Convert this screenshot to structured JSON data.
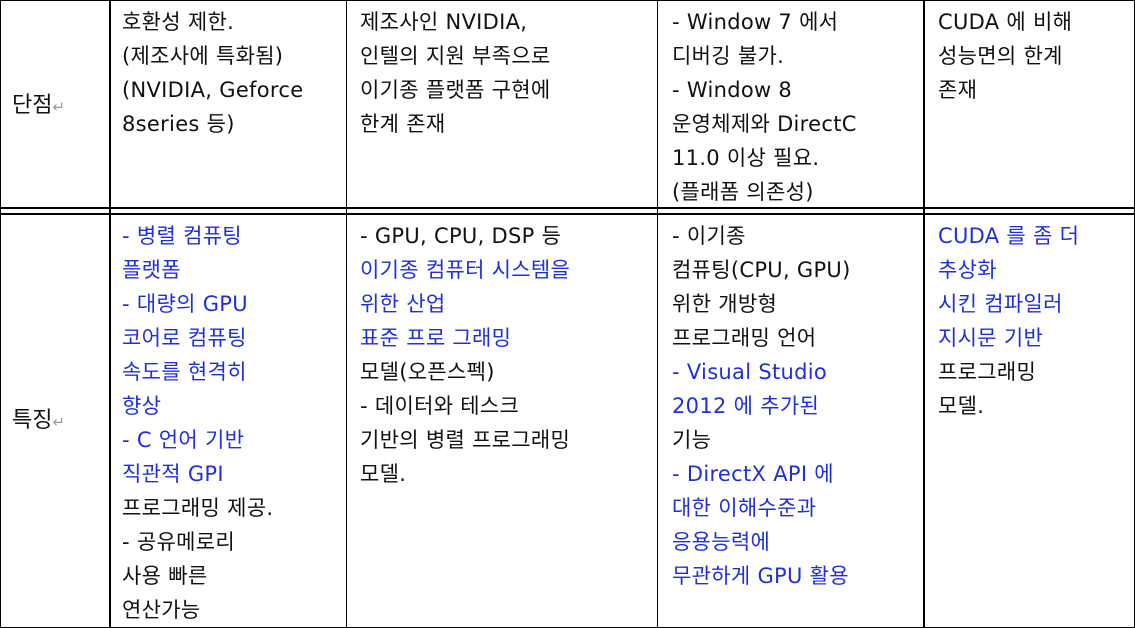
{
  "table": {
    "paragraph_mark": "↵",
    "rows": [
      {
        "header": "단점",
        "cells": [
          {
            "lines": [
              {
                "text": "호환성 제한.",
                "blue": false
              },
              {
                "text": "(제조사에 특화됨)",
                "blue": false
              },
              {
                "text": "(NVIDIA, Geforce",
                "blue": false
              },
              {
                "text": "8series 등)",
                "blue": false
              }
            ]
          },
          {
            "lines": [
              {
                "text": "제조사인 NVIDIA,",
                "blue": false
              },
              {
                "text": "인텔의 지원 부족으로",
                "blue": false
              },
              {
                "text": "이기종 플랫폼 구현에",
                "blue": false
              },
              {
                "text": "한계 존재",
                "blue": false
              }
            ]
          },
          {
            "lines": [
              {
                "text": "- Window 7 에서",
                "blue": false
              },
              {
                "text": "디버깅 불가.",
                "blue": false
              },
              {
                "text": "- Window 8",
                "blue": false
              },
              {
                "text": "운영체제와 DirectC",
                "blue": false
              },
              {
                "text": "11.0 이상 필요.",
                "blue": false
              },
              {
                "text": "(플래폼 의존성)",
                "blue": false
              }
            ]
          },
          {
            "lines": [
              {
                "text": "CUDA 에 비해",
                "blue": false
              },
              {
                "text": "성능면의 한계",
                "blue": false
              },
              {
                "text": "존재",
                "blue": false
              }
            ]
          }
        ]
      },
      {
        "header": "특징",
        "cells": [
          {
            "lines": [
              {
                "text": "- 병렬 컴퓨팅",
                "blue": true
              },
              {
                "text": "플랫폼",
                "blue": true
              },
              {
                "text": "- 대량의 GPU",
                "blue": true
              },
              {
                "text": "코어로 컴퓨팅",
                "blue": true
              },
              {
                "text": "속도를 현격히",
                "blue": true
              },
              {
                "text": "향상",
                "blue": true
              },
              {
                "text": "- C 언어 기반",
                "blue": true
              },
              {
                "text": "직관적 GPI",
                "blue": true
              },
              {
                "text": "프로그래밍 제공.",
                "blue": false
              },
              {
                "text": "- 공유메로리",
                "blue": false
              },
              {
                "text": "사용 빠른",
                "blue": false
              },
              {
                "text": "연산가능",
                "blue": false
              }
            ]
          },
          {
            "lines": [
              {
                "text": "- GPU, CPU, DSP 등",
                "blue": false
              },
              {
                "text": "이기종 컴퓨터 시스템을",
                "blue": true
              },
              {
                "text": "위한 산업",
                "blue": true
              },
              {
                "text": "표준 프로 그래밍",
                "blue": true
              },
              {
                "text": "모델(오픈스펙)",
                "blue": false
              },
              {
                "text": "- 데이터와 테스크",
                "blue": false
              },
              {
                "text": "기반의 병렬 프로그래밍",
                "blue": false
              },
              {
                "text": "모델.",
                "blue": false
              }
            ]
          },
          {
            "lines": [
              {
                "text": "- 이기종",
                "blue": false
              },
              {
                "text": "컴퓨팅(CPU, GPU)",
                "blue": false
              },
              {
                "text": "위한 개방형",
                "blue": false
              },
              {
                "text": "프로그래밍 언어",
                "blue": false
              },
              {
                "text": "- Visual Studio",
                "blue": true
              },
              {
                "text": "2012 에 추가된",
                "blue": true
              },
              {
                "text": "기능",
                "blue": false
              },
              {
                "text": "- DirectX API 에",
                "blue": true
              },
              {
                "text": "대한 이해수준과",
                "blue": true
              },
              {
                "text": "응용능력에",
                "blue": true
              },
              {
                "text": "무관하게 GPU 활용",
                "blue": true
              }
            ]
          },
          {
            "lines": [
              {
                "text": "CUDA 를 좀 더",
                "blue": true
              },
              {
                "text": "추상화",
                "blue": true
              },
              {
                "text": "시킨 컴파일러",
                "blue": true
              },
              {
                "text": "지시문 기반",
                "blue": true
              },
              {
                "text": "프로그래밍",
                "blue": false
              },
              {
                "text": "모델.",
                "blue": false
              }
            ]
          }
        ]
      }
    ]
  }
}
